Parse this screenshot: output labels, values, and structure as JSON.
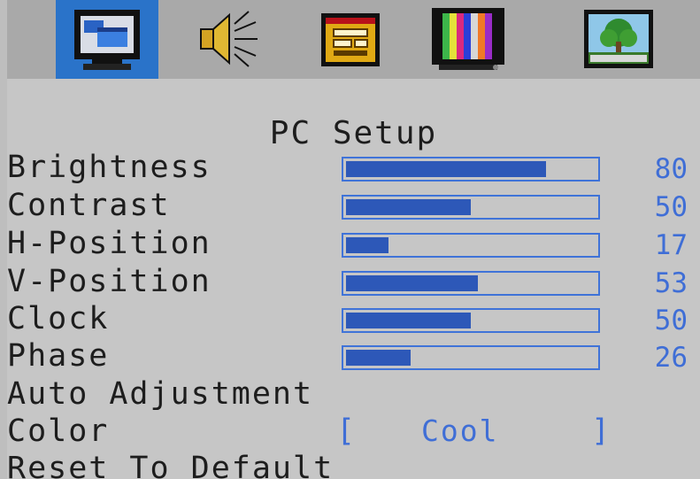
{
  "menu": {
    "tabs": [
      {
        "icon": "monitor-icon",
        "active": true
      },
      {
        "icon": "speaker-icon",
        "active": false
      },
      {
        "icon": "settings-panel-icon",
        "active": false
      },
      {
        "icon": "color-bars-icon",
        "active": false
      },
      {
        "icon": "picture-tree-icon",
        "active": false
      }
    ]
  },
  "page": {
    "title": "PC Setup",
    "items": [
      {
        "label": "Brightness",
        "value": "80",
        "level": 80
      },
      {
        "label": "Contrast",
        "value": "50",
        "level": 50
      },
      {
        "label": "H-Position",
        "value": "17",
        "level": 17
      },
      {
        "label": "V-Position",
        "value": "53",
        "level": 53
      },
      {
        "label": "Clock",
        "value": "50",
        "level": 50
      },
      {
        "label": "Phase",
        "value": "26",
        "level": 26
      }
    ],
    "auto_adjust_label": "Auto Adjustment",
    "color": {
      "label": "Color",
      "bracket_open": "[",
      "value": "Cool",
      "bracket_close": "]"
    },
    "reset_label": "Reset To Default"
  },
  "colors": {
    "active_tab": "#2a73c9",
    "value_text": "#3f6ed6",
    "bar_fill": "#2d58b8",
    "bar_border": "#3f73d8"
  }
}
